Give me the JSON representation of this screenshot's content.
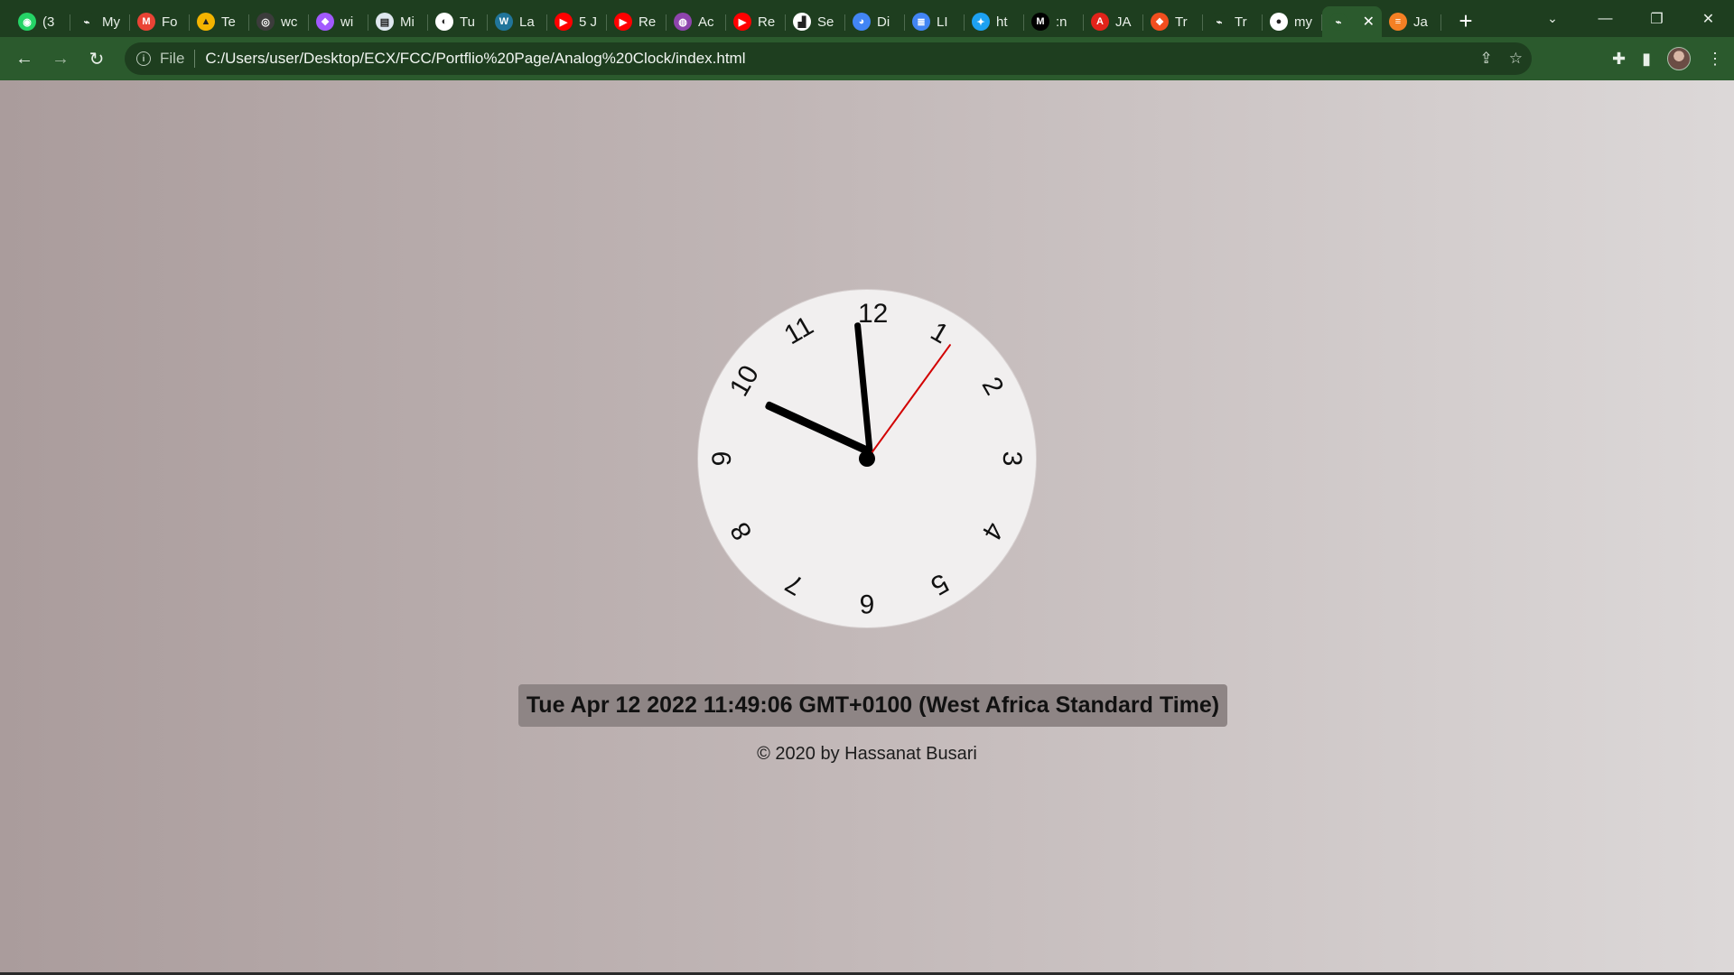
{
  "browser": {
    "tabs": [
      {
        "title": "(3",
        "icon": "whatsapp-icon",
        "color": "#25d366",
        "glyph": "◉"
      },
      {
        "title": "My",
        "icon": "link-icon",
        "color": "#1e3e1f",
        "glyph": "⌁"
      },
      {
        "title": "Fo",
        "icon": "gmail-icon",
        "color": "#ea4335",
        "glyph": "M"
      },
      {
        "title": "Te",
        "icon": "drive-icon",
        "color": "#f4b400",
        "glyph": "▲"
      },
      {
        "title": "wc",
        "icon": "camera-icon",
        "color": "#3c3c3c",
        "glyph": "◎"
      },
      {
        "title": "wi",
        "icon": "figma-icon",
        "color": "#a259ff",
        "glyph": "❖"
      },
      {
        "title": "Mi",
        "icon": "doc-icon",
        "color": "#dfe7ef",
        "glyph": "▤"
      },
      {
        "title": "Tu",
        "icon": "globe-icon",
        "color": "#ffffff",
        "glyph": "◐"
      },
      {
        "title": "La",
        "icon": "wordpress-icon",
        "color": "#21759b",
        "glyph": "W"
      },
      {
        "title": "5 J",
        "icon": "youtube-icon",
        "color": "#ff0000",
        "glyph": "▶"
      },
      {
        "title": "Re",
        "icon": "youtube-icon",
        "color": "#ff0000",
        "glyph": "▶"
      },
      {
        "title": "Ac",
        "icon": "podcast-icon",
        "color": "#8e44ad",
        "glyph": "◍"
      },
      {
        "title": "Re",
        "icon": "youtube-icon",
        "color": "#ff0000",
        "glyph": "▶"
      },
      {
        "title": "Se",
        "icon": "stairs-icon",
        "color": "#ffffff",
        "glyph": "▟"
      },
      {
        "title": "Di",
        "icon": "chrome-icon",
        "color": "#4285f4",
        "glyph": "◕"
      },
      {
        "title": "LI",
        "icon": "docs-icon",
        "color": "#4285f4",
        "glyph": "≣"
      },
      {
        "title": "ht",
        "icon": "twitter-icon",
        "color": "#1da1f2",
        "glyph": "✦"
      },
      {
        "title": ":n",
        "icon": "medium-icon",
        "color": "#000000",
        "glyph": "M"
      },
      {
        "title": "JA",
        "icon": "pdf-icon",
        "color": "#e2231a",
        "glyph": "A"
      },
      {
        "title": "Tr",
        "icon": "figma-icon",
        "color": "#f24e1e",
        "glyph": "❖"
      },
      {
        "title": "Tr",
        "icon": "link-icon",
        "color": "#1e3e1f",
        "glyph": "⌁"
      },
      {
        "title": "my",
        "icon": "github-icon",
        "color": "#ffffff",
        "glyph": "●"
      },
      {
        "title": "",
        "icon": "link-icon",
        "color": "#2b5a2d",
        "glyph": "⌁",
        "active": true
      },
      {
        "title": "Ja",
        "icon": "stackoverflow-icon",
        "color": "#f48024",
        "glyph": "≡"
      }
    ],
    "new_tab_label": "+",
    "close_glyph": "✕",
    "file_label": "File",
    "url": "C:/Users/user/Desktop/ECX/FCC/Portflio%20Page/Analog%20Clock/index.html"
  },
  "clock": {
    "numerals": [
      "12",
      "1",
      "2",
      "3",
      "4",
      "5",
      "6",
      "7",
      "8",
      "9",
      "10",
      "11"
    ],
    "time": {
      "hours": 11,
      "minutes": 49,
      "seconds": 6
    },
    "colors": {
      "face": "#f1efef",
      "hands": "#000000",
      "second_hand": "#d20000"
    }
  },
  "date_text": "Tue Apr 12 2022 11:49:06 GMT+0100 (West Africa Standard Time)",
  "footer_text": "© 2020 by Hassanat Busari"
}
